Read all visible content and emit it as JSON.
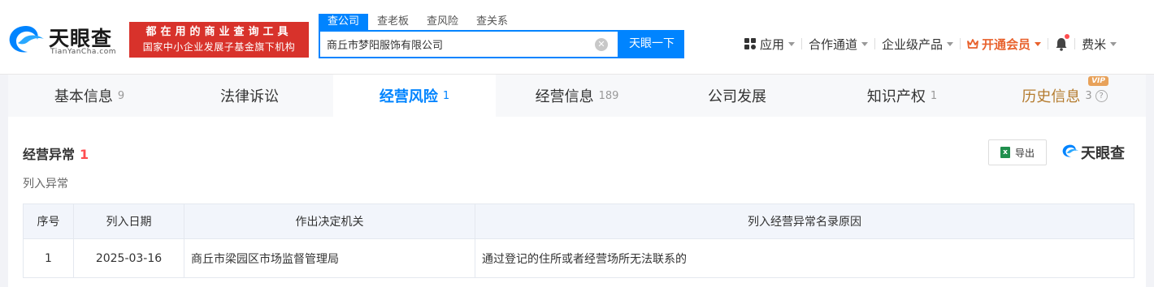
{
  "header": {
    "logo_text": "天眼查",
    "logo_sub": "TianYanCha.com",
    "banner_line1": "都在用的商业查询工具",
    "banner_line2": "国家中小企业发展子基金旗下机构",
    "search_tabs": [
      "查公司",
      "查老板",
      "查风险",
      "查关系"
    ],
    "search_value": "商丘市梦阳服饰有限公司",
    "search_button": "天眼一下",
    "nav": {
      "apps": "应用",
      "channel": "合作通道",
      "enterprise": "企业级产品",
      "vip": "开通会员",
      "user": "费米"
    }
  },
  "tabs": [
    {
      "label": "基本信息",
      "count": "9"
    },
    {
      "label": "法律诉讼",
      "count": ""
    },
    {
      "label": "经营风险",
      "count": "1"
    },
    {
      "label": "经营信息",
      "count": "189"
    },
    {
      "label": "公司发展",
      "count": ""
    },
    {
      "label": "知识产权",
      "count": "1"
    },
    {
      "label": "历史信息",
      "count": "3"
    }
  ],
  "vip_badge": "VIP",
  "section": {
    "title": "经营异常",
    "count": "1",
    "subtitle": "列入异常",
    "export_label": "导出",
    "brand": "天眼查"
  },
  "table": {
    "headers": [
      "序号",
      "列入日期",
      "作出决定机关",
      "列入经营异常名录原因"
    ],
    "rows": [
      [
        "1",
        "2025-03-16",
        "商丘市梁园区市场监督管理局",
        "通过登记的住所或者经营场所无法联系的"
      ]
    ]
  },
  "colors": {
    "accent": "#0084ff",
    "banner_red": "#d8322b",
    "vip_orange": "#e8612c"
  }
}
